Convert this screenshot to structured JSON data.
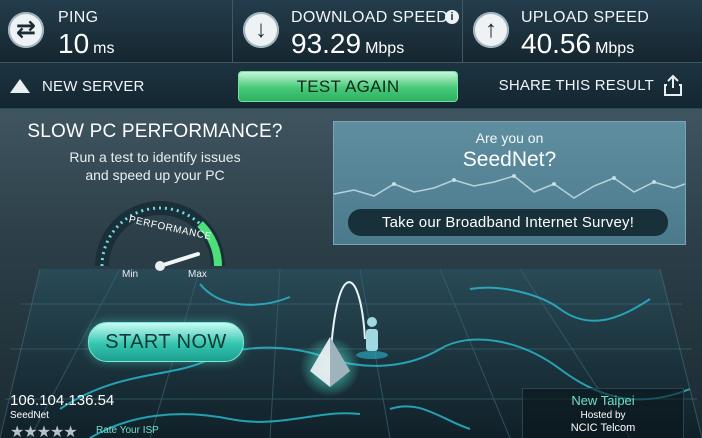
{
  "metrics": {
    "ping": {
      "label": "PING",
      "value": "10",
      "unit": "ms"
    },
    "download": {
      "label": "DOWNLOAD SPEED",
      "value": "93.29",
      "unit": "Mbps"
    },
    "upload": {
      "label": "UPLOAD SPEED",
      "value": "40.56",
      "unit": "Mbps"
    }
  },
  "actions": {
    "new_server": "NEW SERVER",
    "test_again": "TEST AGAIN",
    "share": "SHARE THIS RESULT"
  },
  "ad": {
    "title": "SLOW PC PERFORMANCE?",
    "line1": "Run a test to identify issues",
    "line2": "and speed up your PC",
    "gauge_label": "PERFORMANCE",
    "gauge_min": "Min",
    "gauge_max": "Max",
    "cta": "START NOW"
  },
  "survey": {
    "question": "Are you on",
    "isp": "SeedNet?",
    "button": "Take our Broadband Internet Survey!"
  },
  "client": {
    "ip": "106.104.136.54",
    "isp": "SeedNet",
    "stars": "★★★★★",
    "rate_label": "Rate Your ISP"
  },
  "server": {
    "city": "New Taipei",
    "hosted_by": "Hosted by",
    "sponsor": "NCIC Telcom"
  },
  "colors": {
    "accent_green": "#46c978",
    "accent_teal": "#34c5b0",
    "map_line": "#29b6c9"
  },
  "icons": {
    "ping": "ping-arrows-icon",
    "download": "download-arrow-icon",
    "upload": "upload-arrow-icon",
    "info": "info-icon",
    "server": "pyramid-icon",
    "share": "share-icon"
  }
}
